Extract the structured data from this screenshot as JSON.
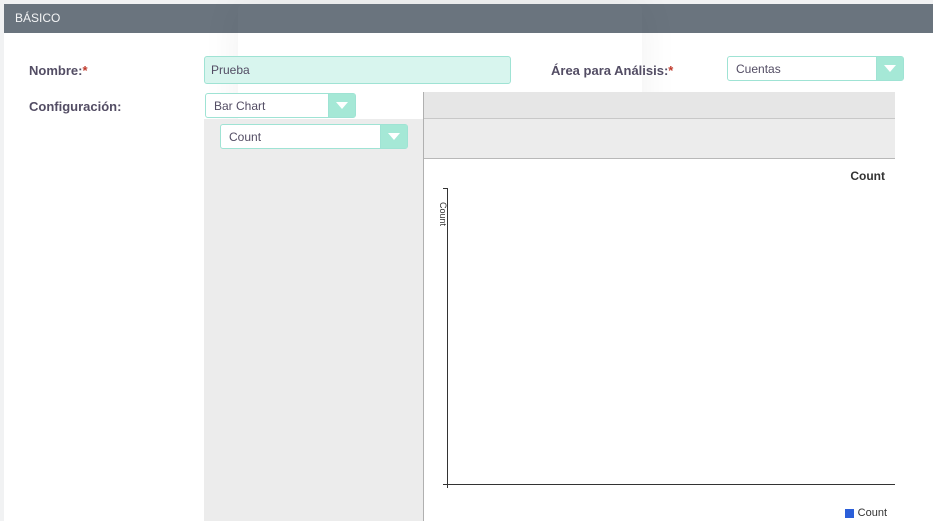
{
  "panel": {
    "title": "BÁSICO"
  },
  "form": {
    "nombre": {
      "label": "Nombre:",
      "required_mark": "*",
      "value": "Prueba"
    },
    "area": {
      "label": "Área para Análisis:",
      "required_mark": "*",
      "selected": "Cuentas"
    },
    "configuracion": {
      "label": "Configuración:",
      "chart_type": "Bar Chart",
      "metric": "Count"
    }
  },
  "chart_data": {
    "type": "bar",
    "title": "Count",
    "ylabel": "Count",
    "xlabel": "",
    "categories": [],
    "series": [
      {
        "name": "Count",
        "values": [],
        "color": "#2b5fd9"
      }
    ]
  },
  "colors": {
    "header_bg": "#6a747e",
    "accent": "#a5e8d6",
    "required": "#c0392b"
  }
}
